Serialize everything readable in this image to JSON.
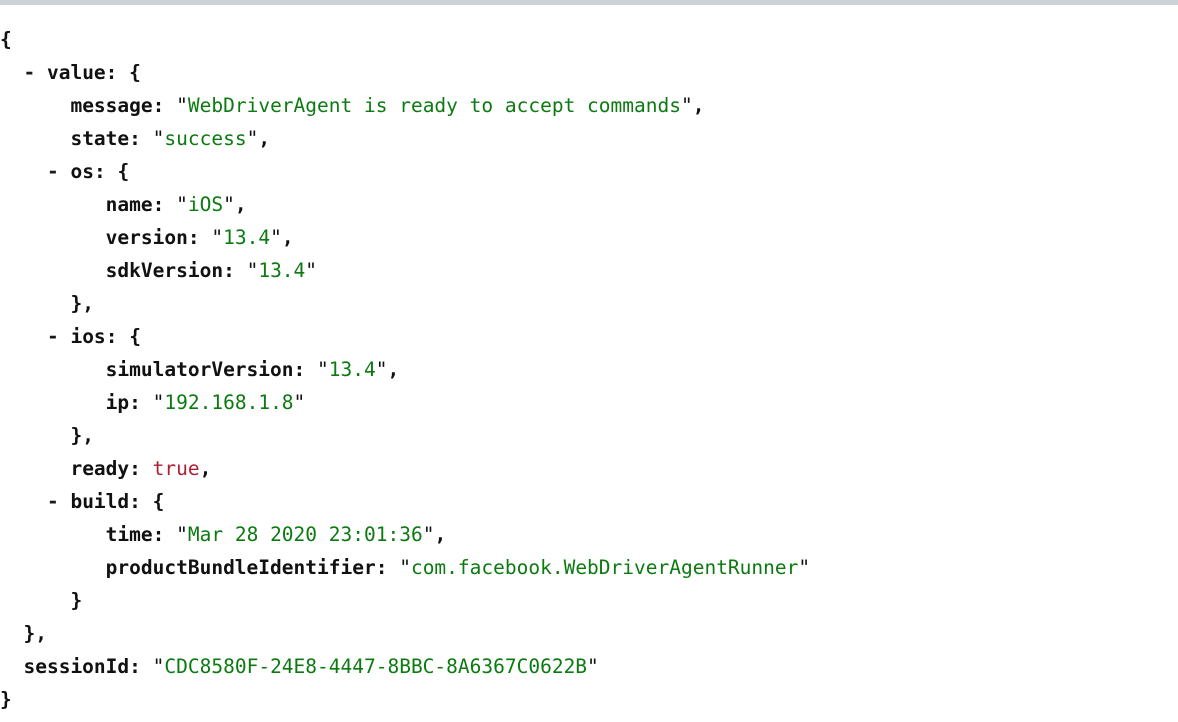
{
  "window": {
    "title_strip_color": "#ccd1d6"
  },
  "colors": {
    "key": "#111111",
    "string": "#0c7a11",
    "boolean": "#ad1f33",
    "punctuation": "#111111",
    "background": "#ffffff",
    "top_strip": "#ccd1d6"
  },
  "document": {
    "format": "json-tree",
    "lines": [
      {
        "id": "line-open-root",
        "indent": 0,
        "marker": "",
        "key": "",
        "value": "",
        "value_type": "brace",
        "text": "{"
      },
      {
        "id": "line-value",
        "indent": 2,
        "marker": "-",
        "key": "value",
        "value": "{",
        "value_type": "object-open"
      },
      {
        "id": "line-message",
        "indent": 6,
        "marker": "",
        "key": "message",
        "value": "WebDriverAgent is ready to accept commands",
        "value_type": "string",
        "trailing": ","
      },
      {
        "id": "line-state",
        "indent": 6,
        "marker": "",
        "key": "state",
        "value": "success",
        "value_type": "string",
        "trailing": ","
      },
      {
        "id": "line-os",
        "indent": 4,
        "marker": "-",
        "key": "os",
        "value": "{",
        "value_type": "object-open"
      },
      {
        "id": "line-os-name",
        "indent": 9,
        "marker": "",
        "key": "name",
        "value": "iOS",
        "value_type": "string",
        "trailing": ","
      },
      {
        "id": "line-os-version",
        "indent": 9,
        "marker": "",
        "key": "version",
        "value": "13.4",
        "value_type": "string",
        "trailing": ","
      },
      {
        "id": "line-os-sdkversion",
        "indent": 9,
        "marker": "",
        "key": "sdkVersion",
        "value": "13.4",
        "value_type": "string",
        "trailing": ""
      },
      {
        "id": "line-os-close",
        "indent": 6,
        "marker": "",
        "key": "",
        "value": "},",
        "value_type": "object-close"
      },
      {
        "id": "line-ios",
        "indent": 4,
        "marker": "-",
        "key": "ios",
        "value": "{",
        "value_type": "object-open"
      },
      {
        "id": "line-ios-simulatorversion",
        "indent": 9,
        "marker": "",
        "key": "simulatorVersion",
        "value": "13.4",
        "value_type": "string",
        "trailing": ","
      },
      {
        "id": "line-ios-ip",
        "indent": 9,
        "marker": "",
        "key": "ip",
        "value": "192.168.1.8",
        "value_type": "string",
        "trailing": ""
      },
      {
        "id": "line-ios-close",
        "indent": 6,
        "marker": "",
        "key": "",
        "value": "},",
        "value_type": "object-close"
      },
      {
        "id": "line-ready",
        "indent": 6,
        "marker": "",
        "key": "ready",
        "value": "true",
        "value_type": "boolean",
        "trailing": ","
      },
      {
        "id": "line-build",
        "indent": 4,
        "marker": "-",
        "key": "build",
        "value": "{",
        "value_type": "object-open"
      },
      {
        "id": "line-build-time",
        "indent": 9,
        "marker": "",
        "key": "time",
        "value": "Mar 28 2020 23:01:36",
        "value_type": "string",
        "trailing": ","
      },
      {
        "id": "line-build-bundleid",
        "indent": 9,
        "marker": "",
        "key": "productBundleIdentifier",
        "value": "com.facebook.WebDriverAgentRunner",
        "value_type": "string",
        "trailing": ""
      },
      {
        "id": "line-build-close",
        "indent": 6,
        "marker": "",
        "key": "",
        "value": "}",
        "value_type": "object-close"
      },
      {
        "id": "line-value-close",
        "indent": 2,
        "marker": "",
        "key": "",
        "value": "},",
        "value_type": "object-close"
      },
      {
        "id": "line-sessionid",
        "indent": 2,
        "marker": "",
        "key": "sessionId",
        "value": "CDC8580F-24E8-4447-8BBC-8A6367C0622B",
        "value_type": "string",
        "trailing": ""
      },
      {
        "id": "line-close-root",
        "indent": 0,
        "marker": "",
        "key": "",
        "value": "}",
        "value_type": "brace",
        "text": "}"
      }
    ]
  }
}
